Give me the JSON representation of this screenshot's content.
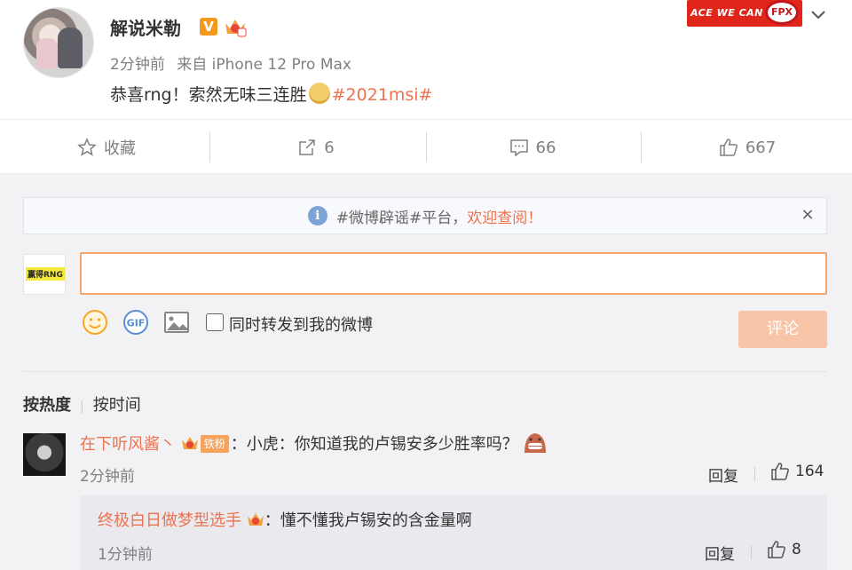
{
  "post": {
    "username": "解说米勒",
    "verified_badge": "V",
    "time": "2分钟前",
    "source": "来自 iPhone 12 Pro Max",
    "content_text": "恭喜rng！索然无味三连胜",
    "content_hashtag": "#2021msi#",
    "banner_text": "ACE WE CAN",
    "team_badge": "FPX",
    "icons": {
      "avatar": "avatar",
      "crown": "crown-fan-icon",
      "more": "chevron-down-icon",
      "emoji": "doge-emoji-icon"
    }
  },
  "actions": {
    "favorite": {
      "label": "收藏",
      "icon": "star-icon"
    },
    "repost": {
      "count": "6",
      "icon": "share-icon"
    },
    "comment": {
      "count": "66",
      "icon": "comment-icon"
    },
    "like": {
      "count": "667",
      "icon": "thumb-up-icon"
    }
  },
  "notice": {
    "text": "#微博辟谣#平台，",
    "highlight": "欢迎查阅！",
    "close": "×"
  },
  "composer": {
    "avatar_text": "赢得RNG",
    "input_value": "",
    "repost_checkbox_label": "同时转发到我的微博",
    "submit_label": "评论",
    "tools": [
      "emoji-icon",
      "gif-icon",
      "image-icon"
    ]
  },
  "sort": {
    "hot": "按热度",
    "time": "按时间"
  },
  "comments": [
    {
      "name": "在下听风酱丶",
      "fan_badge": "铁粉",
      "text": "：小虎：你知道我的卢锡安多少胜率吗？",
      "time": "2分钟前",
      "reply_label": "回复",
      "likes": "164",
      "replies": [
        {
          "name": "终极白日做梦型选手",
          "text": "：懂不懂我卢锡安的含金量啊",
          "time": "1分钟前",
          "reply_label": "回复",
          "likes": "8"
        }
      ]
    }
  ],
  "colors": {
    "accent": "#eb7350",
    "input_border": "#f6a66d",
    "submit_bg": "#f8c5a8",
    "area_bg": "#f2f2f5"
  }
}
